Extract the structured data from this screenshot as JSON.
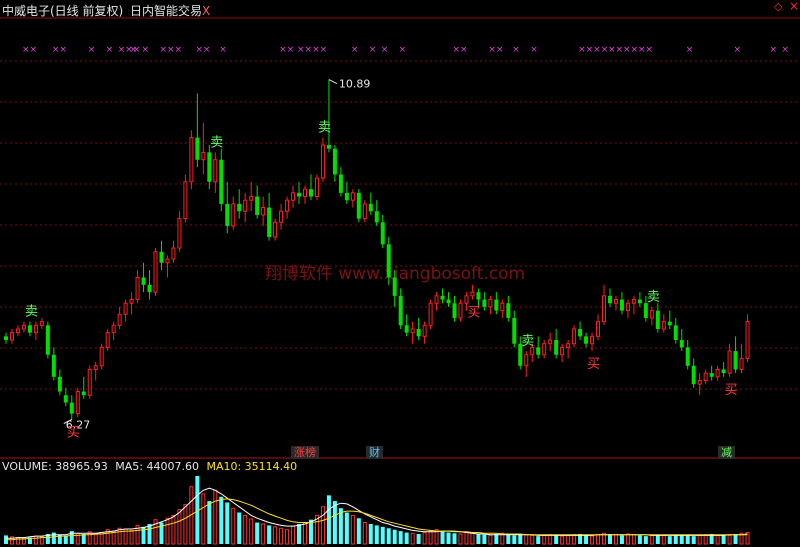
{
  "header": {
    "title": "中威电子(日线 前复权)",
    "indicator": "日内智能交易",
    "close_x": "X"
  },
  "corner_icons": {
    "diamond": "◇",
    "close": "×"
  },
  "watermark": "翔博软件 www.xiangbosoft.com",
  "signals": {
    "buy": "买",
    "sell": "卖"
  },
  "event_tags": [
    {
      "text": "涨榜",
      "color": "#ff3b3b"
    },
    {
      "text": "财",
      "color": "#4fc3ff"
    },
    {
      "text": "减",
      "color": "#5cff5c"
    }
  ],
  "volume_info": {
    "volume_label": "VOLUME: 38965.93",
    "ma5_label": "MA5: 44007.60",
    "ma10_label": "MA10: 35114.40"
  },
  "colors": {
    "up": "#ff2020",
    "down": "#00e000",
    "grid": "#7a1010",
    "marker": "#e040e0",
    "vol_up": "#ff3030",
    "vol_down": "#50ffff",
    "ma5": "#ffffff",
    "ma10": "#ffe020"
  },
  "chart_data": {
    "type": "candlestick",
    "max_label": "10.89",
    "min_label": "6.27",
    "y_range": [
      6.1,
      11.4
    ],
    "candles": [
      [
        7.4,
        7.45,
        7.3,
        7.35
      ],
      [
        7.35,
        7.5,
        7.3,
        7.45
      ],
      [
        7.45,
        7.55,
        7.4,
        7.5
      ],
      [
        7.5,
        7.6,
        7.45,
        7.55
      ],
      [
        7.55,
        7.6,
        7.4,
        7.45
      ],
      [
        7.45,
        7.6,
        7.35,
        7.55
      ],
      [
        7.55,
        7.65,
        7.5,
        7.6
      ],
      [
        7.55,
        7.6,
        7.1,
        7.15
      ],
      [
        7.15,
        7.25,
        6.8,
        6.85
      ],
      [
        6.85,
        6.95,
        6.6,
        6.65
      ],
      [
        6.6,
        6.7,
        6.45,
        6.5
      ],
      [
        6.5,
        6.6,
        6.27,
        6.35
      ],
      [
        6.35,
        6.7,
        6.3,
        6.65
      ],
      [
        6.65,
        6.85,
        6.55,
        6.6
      ],
      [
        6.6,
        7.0,
        6.55,
        6.95
      ],
      [
        6.95,
        7.05,
        6.8,
        7.0
      ],
      [
        7.0,
        7.3,
        6.95,
        7.25
      ],
      [
        7.25,
        7.5,
        7.2,
        7.45
      ],
      [
        7.45,
        7.6,
        7.35,
        7.55
      ],
      [
        7.55,
        7.8,
        7.5,
        7.7
      ],
      [
        7.7,
        7.9,
        7.6,
        7.85
      ],
      [
        7.85,
        8.0,
        7.7,
        7.9
      ],
      [
        7.9,
        8.3,
        7.85,
        8.2
      ],
      [
        8.2,
        8.4,
        8.0,
        8.1
      ],
      [
        8.1,
        8.3,
        7.9,
        8.0
      ],
      [
        8.0,
        8.6,
        7.95,
        8.55
      ],
      [
        8.55,
        8.7,
        8.3,
        8.4
      ],
      [
        8.4,
        8.5,
        8.2,
        8.45
      ],
      [
        8.45,
        8.7,
        8.4,
        8.6
      ],
      [
        8.6,
        9.1,
        8.55,
        9.0
      ],
      [
        9.0,
        9.6,
        8.95,
        9.5
      ],
      [
        9.5,
        10.2,
        9.4,
        10.1
      ],
      [
        10.1,
        10.7,
        9.7,
        9.8
      ],
      [
        9.8,
        10.3,
        9.6,
        9.9
      ],
      [
        9.9,
        10.0,
        9.4,
        9.5
      ],
      [
        9.5,
        9.9,
        9.35,
        9.8
      ],
      [
        9.8,
        9.95,
        9.1,
        9.2
      ],
      [
        9.2,
        9.5,
        8.8,
        8.9
      ],
      [
        8.9,
        9.3,
        8.85,
        9.2
      ],
      [
        9.2,
        9.4,
        9.0,
        9.1
      ],
      [
        9.1,
        9.35,
        8.95,
        9.25
      ],
      [
        9.25,
        9.5,
        9.1,
        9.3
      ],
      [
        9.3,
        9.45,
        9.0,
        9.05
      ],
      [
        9.05,
        9.3,
        8.9,
        9.15
      ],
      [
        9.15,
        9.35,
        8.7,
        8.75
      ],
      [
        8.75,
        9.0,
        8.7,
        8.95
      ],
      [
        8.95,
        9.2,
        8.85,
        9.1
      ],
      [
        9.1,
        9.3,
        9.0,
        9.25
      ],
      [
        9.25,
        9.45,
        9.15,
        9.35
      ],
      [
        9.35,
        9.5,
        9.2,
        9.3
      ],
      [
        9.3,
        9.45,
        9.2,
        9.4
      ],
      [
        9.4,
        9.6,
        9.25,
        9.3
      ],
      [
        9.3,
        9.6,
        9.25,
        9.55
      ],
      [
        9.55,
        10.1,
        9.5,
        10.0
      ],
      [
        10.0,
        10.89,
        9.9,
        9.95
      ],
      [
        9.95,
        10.0,
        9.5,
        9.6
      ],
      [
        9.6,
        9.7,
        9.3,
        9.35
      ],
      [
        9.35,
        9.5,
        9.2,
        9.25
      ],
      [
        9.25,
        9.4,
        9.15,
        9.35
      ],
      [
        9.35,
        9.4,
        8.95,
        9.0
      ],
      [
        9.0,
        9.25,
        8.95,
        9.2
      ],
      [
        9.2,
        9.35,
        9.05,
        9.1
      ],
      [
        9.1,
        9.25,
        8.9,
        8.95
      ],
      [
        8.95,
        9.05,
        8.6,
        8.65
      ],
      [
        8.65,
        8.75,
        8.1,
        8.2
      ],
      [
        8.2,
        8.3,
        7.8,
        7.95
      ],
      [
        7.95,
        8.05,
        7.5,
        7.55
      ],
      [
        7.55,
        7.7,
        7.4,
        7.45
      ],
      [
        7.45,
        7.6,
        7.3,
        7.5
      ],
      [
        7.5,
        7.65,
        7.35,
        7.4
      ],
      [
        7.4,
        7.6,
        7.3,
        7.55
      ],
      [
        7.55,
        7.9,
        7.5,
        7.85
      ],
      [
        7.85,
        8.0,
        7.75,
        7.95
      ],
      [
        7.95,
        8.05,
        7.85,
        7.9
      ],
      [
        7.9,
        8.0,
        7.8,
        7.85
      ],
      [
        7.85,
        7.95,
        7.6,
        7.65
      ],
      [
        7.65,
        7.9,
        7.6,
        7.85
      ],
      [
        7.85,
        8.0,
        7.75,
        7.95
      ],
      [
        7.95,
        8.1,
        7.9,
        8.0
      ],
      [
        8.0,
        8.05,
        7.8,
        7.9
      ],
      [
        7.9,
        8.0,
        7.75,
        7.8
      ],
      [
        7.8,
        7.95,
        7.7,
        7.9
      ],
      [
        7.9,
        8.0,
        7.7,
        7.75
      ],
      [
        7.75,
        7.9,
        7.65,
        7.85
      ],
      [
        7.85,
        7.95,
        7.6,
        7.65
      ],
      [
        7.65,
        7.75,
        7.25,
        7.3
      ],
      [
        7.3,
        7.4,
        6.95,
        7.0
      ],
      [
        7.0,
        7.2,
        6.85,
        7.15
      ],
      [
        7.15,
        7.3,
        7.05,
        7.25
      ],
      [
        7.25,
        7.4,
        7.1,
        7.15
      ],
      [
        7.15,
        7.35,
        7.1,
        7.3
      ],
      [
        7.3,
        7.45,
        7.2,
        7.35
      ],
      [
        7.35,
        7.5,
        7.1,
        7.15
      ],
      [
        7.15,
        7.3,
        7.05,
        7.25
      ],
      [
        7.25,
        7.35,
        7.1,
        7.3
      ],
      [
        7.3,
        7.55,
        7.25,
        7.5
      ],
      [
        7.5,
        7.6,
        7.35,
        7.4
      ],
      [
        7.4,
        7.45,
        7.25,
        7.3
      ],
      [
        7.3,
        7.45,
        7.2,
        7.4
      ],
      [
        7.4,
        7.7,
        7.35,
        7.6
      ],
      [
        7.6,
        8.1,
        7.55,
        7.95
      ],
      [
        7.95,
        8.05,
        7.8,
        7.85
      ],
      [
        7.85,
        7.95,
        7.75,
        7.9
      ],
      [
        7.9,
        8.0,
        7.7,
        7.75
      ],
      [
        7.75,
        7.9,
        7.65,
        7.85
      ],
      [
        7.85,
        7.95,
        7.7,
        7.9
      ],
      [
        7.9,
        8.0,
        7.8,
        7.85
      ],
      [
        7.85,
        7.95,
        7.6,
        7.65
      ],
      [
        7.65,
        7.8,
        7.55,
        7.75
      ],
      [
        7.75,
        7.85,
        7.45,
        7.5
      ],
      [
        7.5,
        7.7,
        7.45,
        7.6
      ],
      [
        7.6,
        7.75,
        7.5,
        7.55
      ],
      [
        7.55,
        7.65,
        7.3,
        7.35
      ],
      [
        7.35,
        7.5,
        7.2,
        7.25
      ],
      [
        7.25,
        7.35,
        6.95,
        7.0
      ],
      [
        7.0,
        7.1,
        6.7,
        6.75
      ],
      [
        6.75,
        6.9,
        6.6,
        6.8
      ],
      [
        6.8,
        6.95,
        6.75,
        6.9
      ],
      [
        6.9,
        7.0,
        6.8,
        6.85
      ],
      [
        6.85,
        7.0,
        6.8,
        6.95
      ],
      [
        6.95,
        7.05,
        6.85,
        6.9
      ],
      [
        6.9,
        7.3,
        6.85,
        7.2
      ],
      [
        7.2,
        7.4,
        6.9,
        6.95
      ],
      [
        6.95,
        7.3,
        6.9,
        7.1
      ],
      [
        7.1,
        7.7,
        7.05,
        7.6
      ]
    ],
    "volume": [
      12,
      10,
      9,
      8,
      9,
      11,
      10,
      14,
      16,
      13,
      12,
      18,
      15,
      14,
      17,
      13,
      16,
      20,
      18,
      22,
      21,
      19,
      26,
      24,
      28,
      34,
      30,
      36,
      40,
      48,
      55,
      80,
      95,
      70,
      60,
      75,
      66,
      58,
      50,
      44,
      40,
      35,
      30,
      28,
      26,
      24,
      22,
      20,
      25,
      28,
      30,
      34,
      40,
      52,
      68,
      60,
      50,
      44,
      40,
      36,
      30,
      28,
      26,
      24,
      22,
      20,
      18,
      16,
      15,
      14,
      16,
      18,
      20,
      18,
      16,
      15,
      14,
      16,
      15,
      14,
      13,
      12,
      14,
      15,
      13,
      12,
      14,
      13,
      12,
      11,
      12,
      13,
      12,
      11,
      12,
      13,
      14,
      12,
      11,
      13,
      15,
      14,
      13,
      12,
      14,
      13,
      12,
      11,
      12,
      13,
      12,
      11,
      12,
      13,
      12,
      11,
      12,
      13,
      14,
      12,
      13,
      12,
      14,
      15,
      16
    ],
    "ma5": [
      8,
      8,
      9,
      9,
      10,
      11,
      11,
      12,
      13,
      13,
      13,
      15,
      15,
      15,
      15,
      15,
      16,
      17,
      18,
      20,
      21,
      21,
      22,
      23,
      25,
      28,
      31,
      34,
      38,
      44,
      52,
      60,
      68,
      75,
      78,
      75,
      70,
      64,
      58,
      52,
      46,
      40,
      36,
      33,
      30,
      28,
      26,
      25,
      25,
      26,
      28,
      31,
      35,
      40,
      48,
      54,
      57,
      56,
      52,
      47,
      42,
      38,
      34,
      30,
      28,
      25,
      23,
      21,
      19,
      18,
      17,
      17,
      17,
      18,
      18,
      18,
      17,
      16,
      15,
      14,
      14,
      13,
      13,
      13,
      13,
      13,
      13,
      13,
      13,
      12,
      12,
      12,
      12,
      12,
      12,
      12,
      12,
      12,
      12,
      13,
      13,
      13,
      13,
      13,
      13,
      13,
      13,
      13,
      12,
      12,
      12,
      12,
      12,
      12,
      12,
      12,
      12,
      12,
      12,
      12,
      12,
      13,
      13,
      13,
      14
    ],
    "ma10": [
      6,
      6,
      7,
      7,
      8,
      8,
      9,
      9,
      10,
      11,
      11,
      12,
      12,
      13,
      13,
      14,
      14,
      15,
      16,
      17,
      18,
      18,
      19,
      20,
      21,
      23,
      25,
      27,
      29,
      32,
      36,
      41,
      46,
      51,
      56,
      60,
      62,
      63,
      62,
      60,
      57,
      54,
      50,
      46,
      42,
      39,
      36,
      33,
      31,
      30,
      30,
      30,
      31,
      33,
      36,
      40,
      44,
      46,
      46,
      45,
      43,
      40,
      37,
      34,
      31,
      29,
      27,
      25,
      23,
      21,
      20,
      19,
      18,
      18,
      18,
      17,
      17,
      17,
      16,
      16,
      15,
      15,
      15,
      14,
      14,
      14,
      14,
      13,
      13,
      13,
      13,
      13,
      13,
      13,
      13,
      13,
      13,
      13,
      13,
      13,
      13,
      13,
      13,
      13,
      13,
      13,
      13,
      13,
      13,
      13,
      13,
      13,
      13,
      13,
      13,
      13,
      13,
      13,
      13,
      13,
      13,
      13,
      13,
      13,
      13
    ],
    "sell_at": [
      4,
      35,
      53,
      87,
      108
    ],
    "buy_at": [
      11,
      78,
      98,
      121
    ],
    "x_markers": [
      [
        3,
        2
      ],
      [
        8,
        2
      ],
      [
        14,
        1
      ],
      [
        17,
        1
      ],
      [
        19,
        3
      ],
      [
        21,
        1
      ],
      [
        23,
        1
      ],
      [
        26,
        3
      ],
      [
        32,
        2
      ],
      [
        36,
        1
      ],
      [
        46,
        2
      ],
      [
        49,
        4
      ],
      [
        58,
        1
      ],
      [
        61,
        1
      ],
      [
        63,
        1
      ],
      [
        66,
        1
      ],
      [
        75,
        2
      ],
      [
        81,
        2
      ],
      [
        85,
        1
      ],
      [
        88,
        1
      ],
      [
        96,
        4
      ],
      [
        101,
        4
      ],
      [
        106,
        2
      ],
      [
        114,
        1
      ],
      [
        122,
        1
      ],
      [
        128,
        1
      ],
      [
        130,
        1
      ]
    ]
  }
}
